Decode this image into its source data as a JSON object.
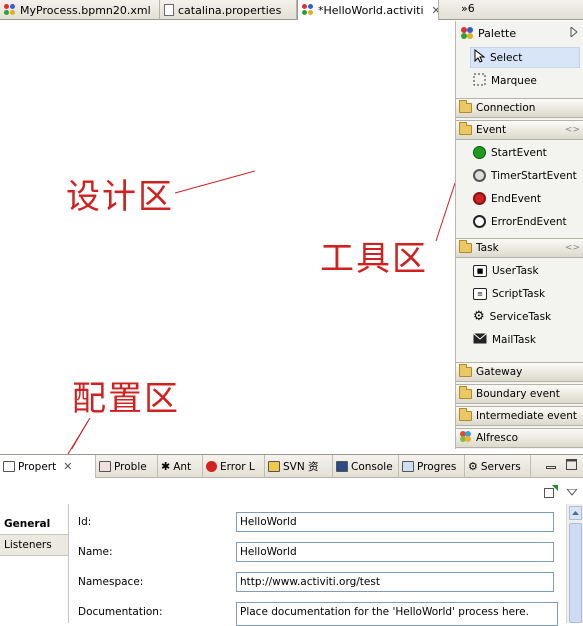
{
  "editor_tabs": [
    {
      "label": "MyProcess.bpmn20.xml",
      "icon": "bpmn-icon"
    },
    {
      "label": "catalina.properties",
      "icon": "properties-file-icon"
    },
    {
      "label": "*HelloWorld.activiti",
      "icon": "bpmn-icon",
      "active": true
    }
  ],
  "more_tabs_label": "»6",
  "annotations": {
    "design": "设计区",
    "tools": "工具区",
    "config": "配置区"
  },
  "annotation_color": "#d02020",
  "palette": {
    "title": "Palette",
    "tools": [
      {
        "label": "Select",
        "icon": "arrow-cursor-icon",
        "selected": true
      },
      {
        "label": "Marquee",
        "icon": "marquee-icon"
      }
    ],
    "drawers": {
      "connection": "Connection",
      "event": "Event",
      "task": "Task",
      "gateway": "Gateway",
      "boundary": "Boundary event",
      "intermediate": "Intermediate event",
      "alfresco": "Alfresco"
    },
    "event_items": [
      {
        "label": "StartEvent",
        "icon": "start-event-icon",
        "color": "#1e9b1e"
      },
      {
        "label": "TimerStartEvent",
        "icon": "timer-event-icon",
        "color": "#666666"
      },
      {
        "label": "EndEvent",
        "icon": "end-event-icon",
        "color": "#d42020"
      },
      {
        "label": "ErrorEndEvent",
        "icon": "error-end-event-icon",
        "color": "#444444"
      }
    ],
    "task_items": [
      {
        "label": "UserTask",
        "icon": "user-task-icon"
      },
      {
        "label": "ScriptTask",
        "icon": "script-task-icon"
      },
      {
        "label": "ServiceTask",
        "icon": "service-task-icon"
      },
      {
        "label": "MailTask",
        "icon": "mail-task-icon"
      }
    ]
  },
  "view_tabs": [
    {
      "label": "Propert",
      "icon": "properties-icon",
      "active": true
    },
    {
      "label": "Proble",
      "icon": "problems-icon"
    },
    {
      "label": "Ant",
      "icon": "ant-icon"
    },
    {
      "label": "Error L",
      "icon": "error-log-icon"
    },
    {
      "label": "SVN 资",
      "icon": "svn-icon"
    },
    {
      "label": "Console",
      "icon": "console-icon"
    },
    {
      "label": "Progres",
      "icon": "progress-icon"
    },
    {
      "label": "Servers",
      "icon": "servers-icon"
    }
  ],
  "properties": {
    "side_tabs": [
      "General",
      "Listeners"
    ],
    "fields": [
      {
        "label": "Id:",
        "value": "HelloWorld"
      },
      {
        "label": "Name:",
        "value": "HelloWorld"
      },
      {
        "label": "Namespace:",
        "value": "http://www.activiti.org/test"
      },
      {
        "label": "Documentation:",
        "value": "Place documentation for the 'HelloWorld' process here."
      }
    ]
  }
}
